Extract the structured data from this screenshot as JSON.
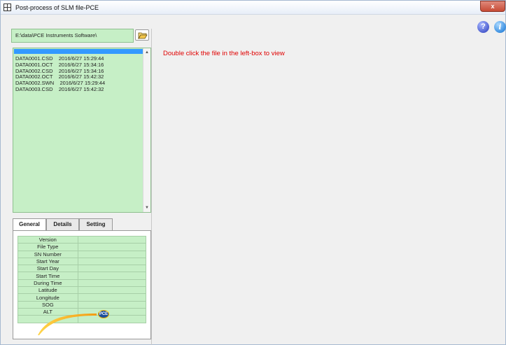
{
  "window": {
    "title": "Post-process of SLM file-PCE",
    "close_label": "x"
  },
  "path": {
    "value": "E:\\data\\PCE Instruments Software\\"
  },
  "icons": {
    "folder": "open-folder-icon",
    "help": "help-icon",
    "info": "info-icon",
    "logo": "pce-logo"
  },
  "file_list": [
    "DATA0001.CSD    2016/6/27 15:29:44",
    "DATA0001.OCT    2016/6/27 15:34:16",
    "DATA0002.CSD    2016/6/27 15:34:16",
    "DATA0002.OCT    2016/6/27 15:42:32",
    "DATA0002.SWN    2016/6/27 15:29:44",
    "DATA0003.CSD    2016/6/27 15:42:32"
  ],
  "tabs": [
    {
      "label": "General",
      "active": true
    },
    {
      "label": "Details",
      "active": false
    },
    {
      "label": "Setting",
      "active": false
    }
  ],
  "info_fields": [
    {
      "label": "Version",
      "value": ""
    },
    {
      "label": "File Type",
      "value": ""
    },
    {
      "label": "SN Number",
      "value": ""
    },
    {
      "label": "Start Year",
      "value": ""
    },
    {
      "label": "Start Day",
      "value": ""
    },
    {
      "label": "Start Time",
      "value": ""
    },
    {
      "label": "During Time",
      "value": ""
    },
    {
      "label": "Latitude",
      "value": ""
    },
    {
      "label": "Longitude",
      "value": ""
    },
    {
      "label": "SOG",
      "value": ""
    },
    {
      "label": "ALT",
      "value": ""
    },
    {
      "label": "",
      "value": ""
    }
  ],
  "main": {
    "message": "Double click the file in the left-box to view"
  },
  "logo": {
    "text": "PCE"
  },
  "colors": {
    "list_bg": "#c6efc6",
    "selection": "#3399ff",
    "message": "#e00000"
  },
  "help_label": "?",
  "info_label": "i"
}
